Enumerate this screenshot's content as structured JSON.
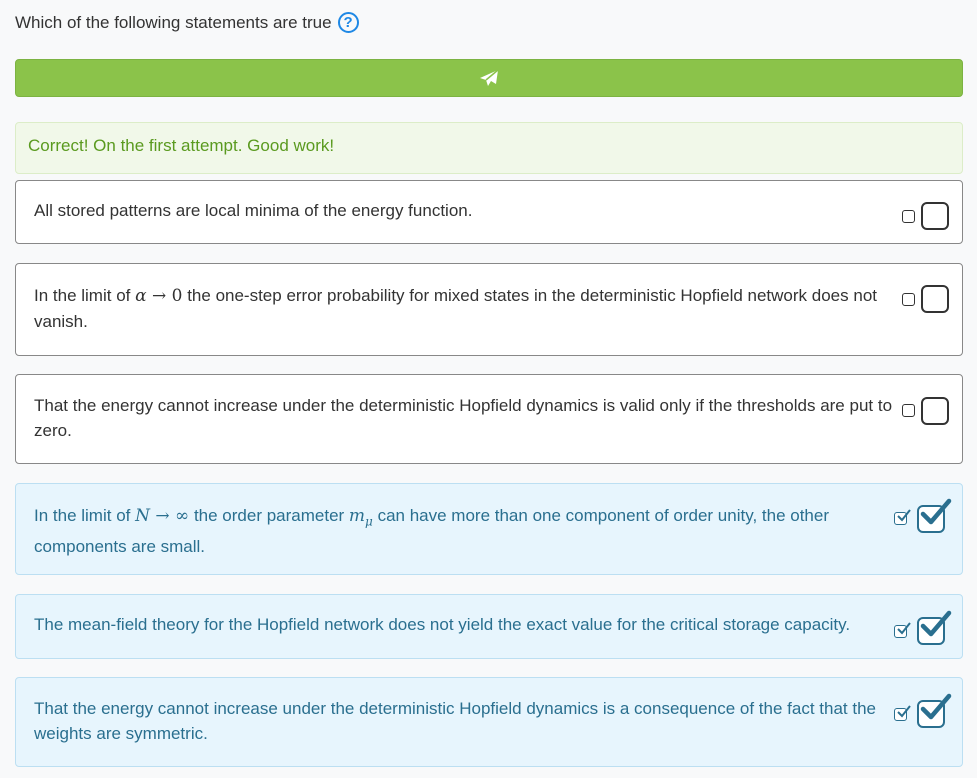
{
  "question": {
    "text": "Which of the following statements are true",
    "help_icon": "question-circle-icon"
  },
  "submit": {
    "icon": "paper-plane-icon",
    "color": "#8bc34a"
  },
  "feedback": {
    "text": "Correct! On the first attempt. Good work!"
  },
  "options": [
    {
      "text": "All stored patterns are local minima of the energy function.",
      "checked": false
    },
    {
      "pre": "In the limit of ",
      "math1": "α",
      "arrow": " → ",
      "math2": "0",
      "post": " the one-step error probability for mixed states in the deterministic Hopfield network does not vanish.",
      "checked": false
    },
    {
      "text": "That the energy cannot increase under the deterministic Hopfield dynamics is valid only if the thresholds are put to zero.",
      "checked": false
    },
    {
      "pre": "In the limit of ",
      "math1": "N",
      "arrow": " → ",
      "math2": "∞",
      "mid": " the order parameter ",
      "math3": "m",
      "sub": "μ",
      "post": " can have more than one component of order unity, the other components are small.",
      "checked": true
    },
    {
      "text": "The mean-field theory for the Hopfield network does not yield the exact value for the critical storage capacity.",
      "checked": true
    },
    {
      "text": "That the energy cannot increase under the deterministic Hopfield dynamics is a consequence of the fact that the weights are symmetric.",
      "checked": true
    }
  ]
}
